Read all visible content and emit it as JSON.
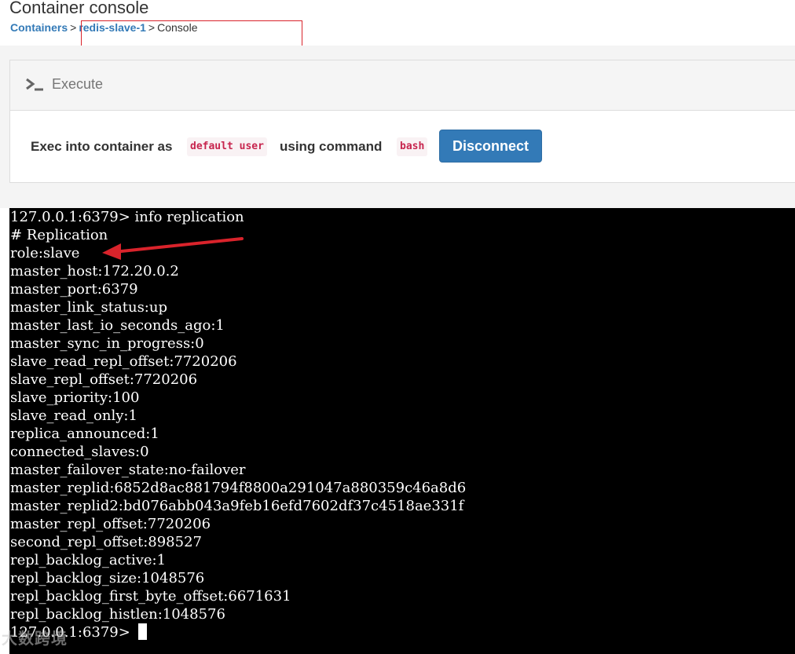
{
  "header": {
    "title": "Container console",
    "breadcrumb": {
      "containers": "Containers",
      "sep1": ">",
      "container": "redis-slave-1",
      "sep2": ">",
      "current": "Console"
    }
  },
  "panel": {
    "icon": "terminal-icon",
    "title": "Execute",
    "exec_label": "Exec into container as",
    "user": "default user",
    "using_label": "using command",
    "command": "bash",
    "disconnect_label": "Disconnect",
    "button_color": "#337ab7"
  },
  "terminal": {
    "lines": [
      "127.0.0.1:6379> info replication",
      "# Replication",
      "role:slave",
      "master_host:172.20.0.2",
      "master_port:6379",
      "master_link_status:up",
      "master_last_io_seconds_ago:1",
      "master_sync_in_progress:0",
      "slave_read_repl_offset:7720206",
      "slave_repl_offset:7720206",
      "slave_priority:100",
      "slave_read_only:1",
      "replica_announced:1",
      "connected_slaves:0",
      "master_failover_state:no-failover",
      "master_replid:6852d8ac881794f8800a291047a880359c46a8d6",
      "master_replid2:bd076abb043a9feb16efd7602df37c4518ae331f",
      "master_repl_offset:7720206",
      "second_repl_offset:898527",
      "repl_backlog_active:1",
      "repl_backlog_size:1048576",
      "repl_backlog_first_byte_offset:6671631",
      "repl_backlog_histlen:1048576"
    ],
    "prompt": "127.0.0.1:6379> ",
    "annotation_color": "#d9232b"
  },
  "watermark": "大数跨境"
}
